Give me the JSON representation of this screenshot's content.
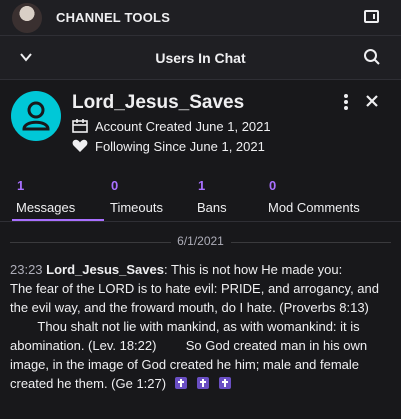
{
  "topbar": {
    "title": "CHANNEL TOOLS"
  },
  "subbar": {
    "title": "Users In Chat"
  },
  "user": {
    "name": "Lord_Jesus_Saves",
    "account_created": "Account Created June 1, 2021",
    "following_since": "Following Since June 1, 2021"
  },
  "stats": [
    {
      "count": "1",
      "label": "Messages"
    },
    {
      "count": "0",
      "label": "Timeouts"
    },
    {
      "count": "1",
      "label": "Bans"
    },
    {
      "count": "0",
      "label": "Mod Comments"
    }
  ],
  "chat": {
    "date": "6/1/2021",
    "time": "23:23",
    "author": "Lord_Jesus_Saves",
    "text_part1": ": This is not how He made you:",
    "text_part2": "The fear of the LORD is to hate evil: PRIDE, and arrogancy, and the evil way, and the froward mouth, do I hate. (Proverbs 8:13)",
    "text_part3": "Thou shalt not lie with mankind, as with womankind: it is abomination. (Lev. 18:22)",
    "text_part4": "So God created man in his own image, in the image of God created he him; male and female created he them. (Ge 1:27)"
  },
  "colors": {
    "accent": "#a970ff",
    "avatar": "#00c8d7",
    "background": "#18181b"
  }
}
